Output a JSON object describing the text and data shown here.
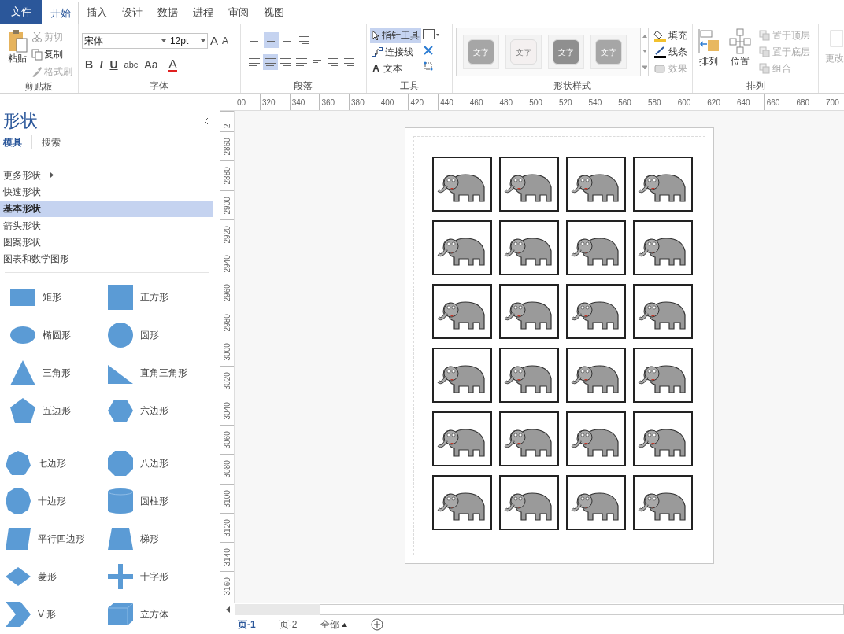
{
  "ribbon": {
    "tabs": [
      {
        "label": "文件",
        "kind": "file",
        "selected": false
      },
      {
        "label": "开始",
        "kind": "tab",
        "selected": true
      },
      {
        "label": "插入",
        "kind": "tab",
        "selected": false
      },
      {
        "label": "设计",
        "kind": "tab",
        "selected": false
      },
      {
        "label": "数据",
        "kind": "tab",
        "selected": false
      },
      {
        "label": "进程",
        "kind": "tab",
        "selected": false
      },
      {
        "label": "审阅",
        "kind": "tab",
        "selected": false
      },
      {
        "label": "视图",
        "kind": "tab",
        "selected": false
      }
    ],
    "clipboard": {
      "label": "剪贴板",
      "paste": "粘贴",
      "items": [
        {
          "kind": "cut",
          "label": "剪切",
          "disabled": true
        },
        {
          "kind": "copy",
          "label": "复制",
          "disabled": false
        },
        {
          "kind": "painter",
          "label": "格式刷",
          "disabled": true
        }
      ]
    },
    "font": {
      "label": "字体",
      "font_name": "宋体",
      "font_size": "12pt",
      "grow": "A",
      "shrink": "A",
      "styles": [
        {
          "kind": "bold",
          "label": "B"
        },
        {
          "kind": "italic",
          "label": "I"
        },
        {
          "kind": "underline",
          "label": "U"
        },
        {
          "kind": "strike",
          "label": "abc"
        },
        {
          "kind": "case",
          "label": "Aa"
        }
      ],
      "font_color": "A"
    },
    "paragraph": {
      "label": "段落"
    },
    "tools": {
      "label": "工具",
      "items": [
        {
          "kind": "pointer",
          "label": "指针工具",
          "selected": true
        },
        {
          "kind": "connector",
          "label": "连接线",
          "selected": false
        },
        {
          "kind": "text",
          "label": "文本",
          "glyph": "A",
          "selected": false
        }
      ]
    },
    "shape_styles": {
      "label": "形状样式",
      "styles": [
        {
          "label": "文字",
          "color": "#a6a6a6"
        },
        {
          "label": "文字",
          "color": "#f4f0f0"
        },
        {
          "label": "文字",
          "color": "#8f8f8f"
        },
        {
          "label": "文字",
          "color": "#a6a6a6"
        }
      ],
      "fill": "填充",
      "line": "线条",
      "effect": {
        "label": "效果",
        "disabled": true
      }
    },
    "arrange": {
      "label": "排列",
      "arrange": "排列",
      "position": "位置",
      "items": [
        {
          "label": "置于顶层",
          "disabled": true
        },
        {
          "label": "置于底层",
          "disabled": true
        },
        {
          "label": "组合",
          "disabled": true
        }
      ]
    },
    "change": "更改"
  },
  "sidebar": {
    "title": "形状",
    "tabs": [
      {
        "label": "模具",
        "selected": true
      },
      {
        "label": "搜索",
        "selected": false
      }
    ],
    "stencils": [
      {
        "label": "更多形状",
        "kind": "submenu",
        "selected": false
      },
      {
        "label": "快速形状",
        "kind": "item",
        "selected": false
      },
      {
        "label": "基本形状",
        "kind": "item",
        "selected": true
      },
      {
        "label": "箭头形状",
        "kind": "item",
        "selected": false
      },
      {
        "label": "图案形状",
        "kind": "item",
        "selected": false
      },
      {
        "label": "图表和数学图形",
        "kind": "item",
        "selected": false
      }
    ],
    "shape_groups": [
      [
        {
          "kind": "rect",
          "label": "矩形"
        },
        {
          "kind": "square",
          "label": "正方形"
        },
        {
          "kind": "ellipse",
          "label": "椭圆形"
        },
        {
          "kind": "circle",
          "label": "圆形"
        },
        {
          "kind": "triangle",
          "label": "三角形"
        },
        {
          "kind": "right-triangle",
          "label": "直角三角形"
        },
        {
          "kind": "pentagon",
          "label": "五边形"
        },
        {
          "kind": "hexagon",
          "label": "六边形"
        }
      ],
      [
        {
          "kind": "heptagon",
          "label": "七边形"
        },
        {
          "kind": "octagon",
          "label": "八边形"
        },
        {
          "kind": "decagon",
          "label": "十边形"
        },
        {
          "kind": "cylinder",
          "label": "圆柱形"
        },
        {
          "kind": "parallelogram",
          "label": "平行四边形"
        },
        {
          "kind": "trapezoid",
          "label": "梯形"
        },
        {
          "kind": "diamond",
          "label": "菱形"
        },
        {
          "kind": "cross",
          "label": "十字形"
        },
        {
          "kind": "chevron",
          "label": "V 形"
        },
        {
          "kind": "cube",
          "label": "立方体"
        }
      ]
    ]
  },
  "rulers": {
    "horizontal": [
      "00",
      "320",
      "340",
      "360",
      "380",
      "400",
      "420",
      "440",
      "460",
      "480",
      "500",
      "520",
      "540",
      "560",
      "580",
      "600",
      "620",
      "640",
      "660",
      "680",
      "700"
    ],
    "vertical": [
      "-2",
      "-2860",
      "-2880",
      "-2900",
      "-2920",
      "-2940",
      "-2960",
      "-2980",
      "-3000",
      "-3020",
      "-3040",
      "-3060",
      "-3080",
      "-3100",
      "-3120",
      "-3140",
      "-3160"
    ]
  },
  "canvas": {
    "tiles": [
      {
        "kind": "elephant"
      },
      {
        "kind": "elephant"
      },
      {
        "kind": "elephant"
      },
      {
        "kind": "elephant"
      },
      {
        "kind": "elephant"
      },
      {
        "kind": "elephant"
      },
      {
        "kind": "elephant"
      },
      {
        "kind": "elephant"
      },
      {
        "kind": "elephant"
      },
      {
        "kind": "elephant"
      },
      {
        "kind": "elephant"
      },
      {
        "kind": "elephant"
      },
      {
        "kind": "elephant"
      },
      {
        "kind": "elephant"
      },
      {
        "kind": "elephant"
      },
      {
        "kind": "elephant"
      },
      {
        "kind": "elephant"
      },
      {
        "kind": "elephant"
      },
      {
        "kind": "elephant"
      },
      {
        "kind": "elephant"
      },
      {
        "kind": "elephant"
      },
      {
        "kind": "elephant"
      },
      {
        "kind": "elephant"
      },
      {
        "kind": "elephant"
      }
    ]
  },
  "page_tabs": [
    {
      "label": "页-1",
      "kind": "page",
      "selected": true
    },
    {
      "label": "页-2",
      "kind": "page",
      "selected": false
    },
    {
      "label": "全部",
      "kind": "all",
      "selected": false
    }
  ]
}
